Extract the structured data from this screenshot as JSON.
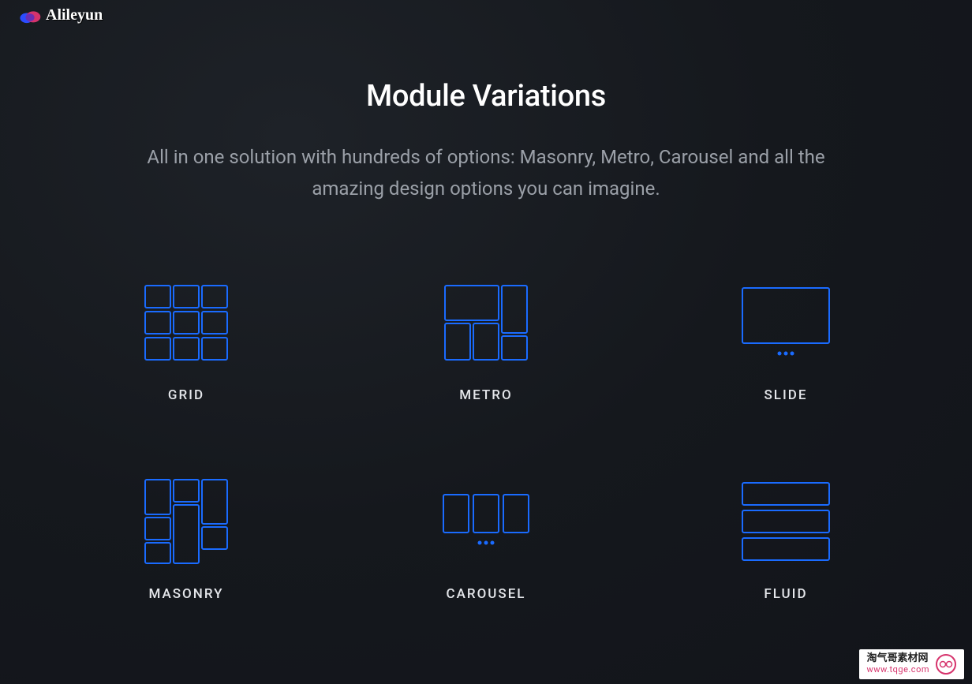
{
  "brand": {
    "name": "Alileyun"
  },
  "hero": {
    "title": "Module Variations",
    "subtitle": "All in one solution with hundreds of options: Masonry, Metro, Carousel and all the amazing design options you can imagine."
  },
  "modules": [
    {
      "label": "GRID",
      "icon": "grid"
    },
    {
      "label": "METRO",
      "icon": "metro"
    },
    {
      "label": "SLIDE",
      "icon": "slide"
    },
    {
      "label": "MASONRY",
      "icon": "masonry"
    },
    {
      "label": "CAROUSEL",
      "icon": "carousel"
    },
    {
      "label": "FLUID",
      "icon": "fluid"
    }
  ],
  "watermark": {
    "line1": "淘气哥素材网",
    "line2": "www.tqge.com"
  },
  "colors": {
    "accent": "#1a6bff"
  }
}
